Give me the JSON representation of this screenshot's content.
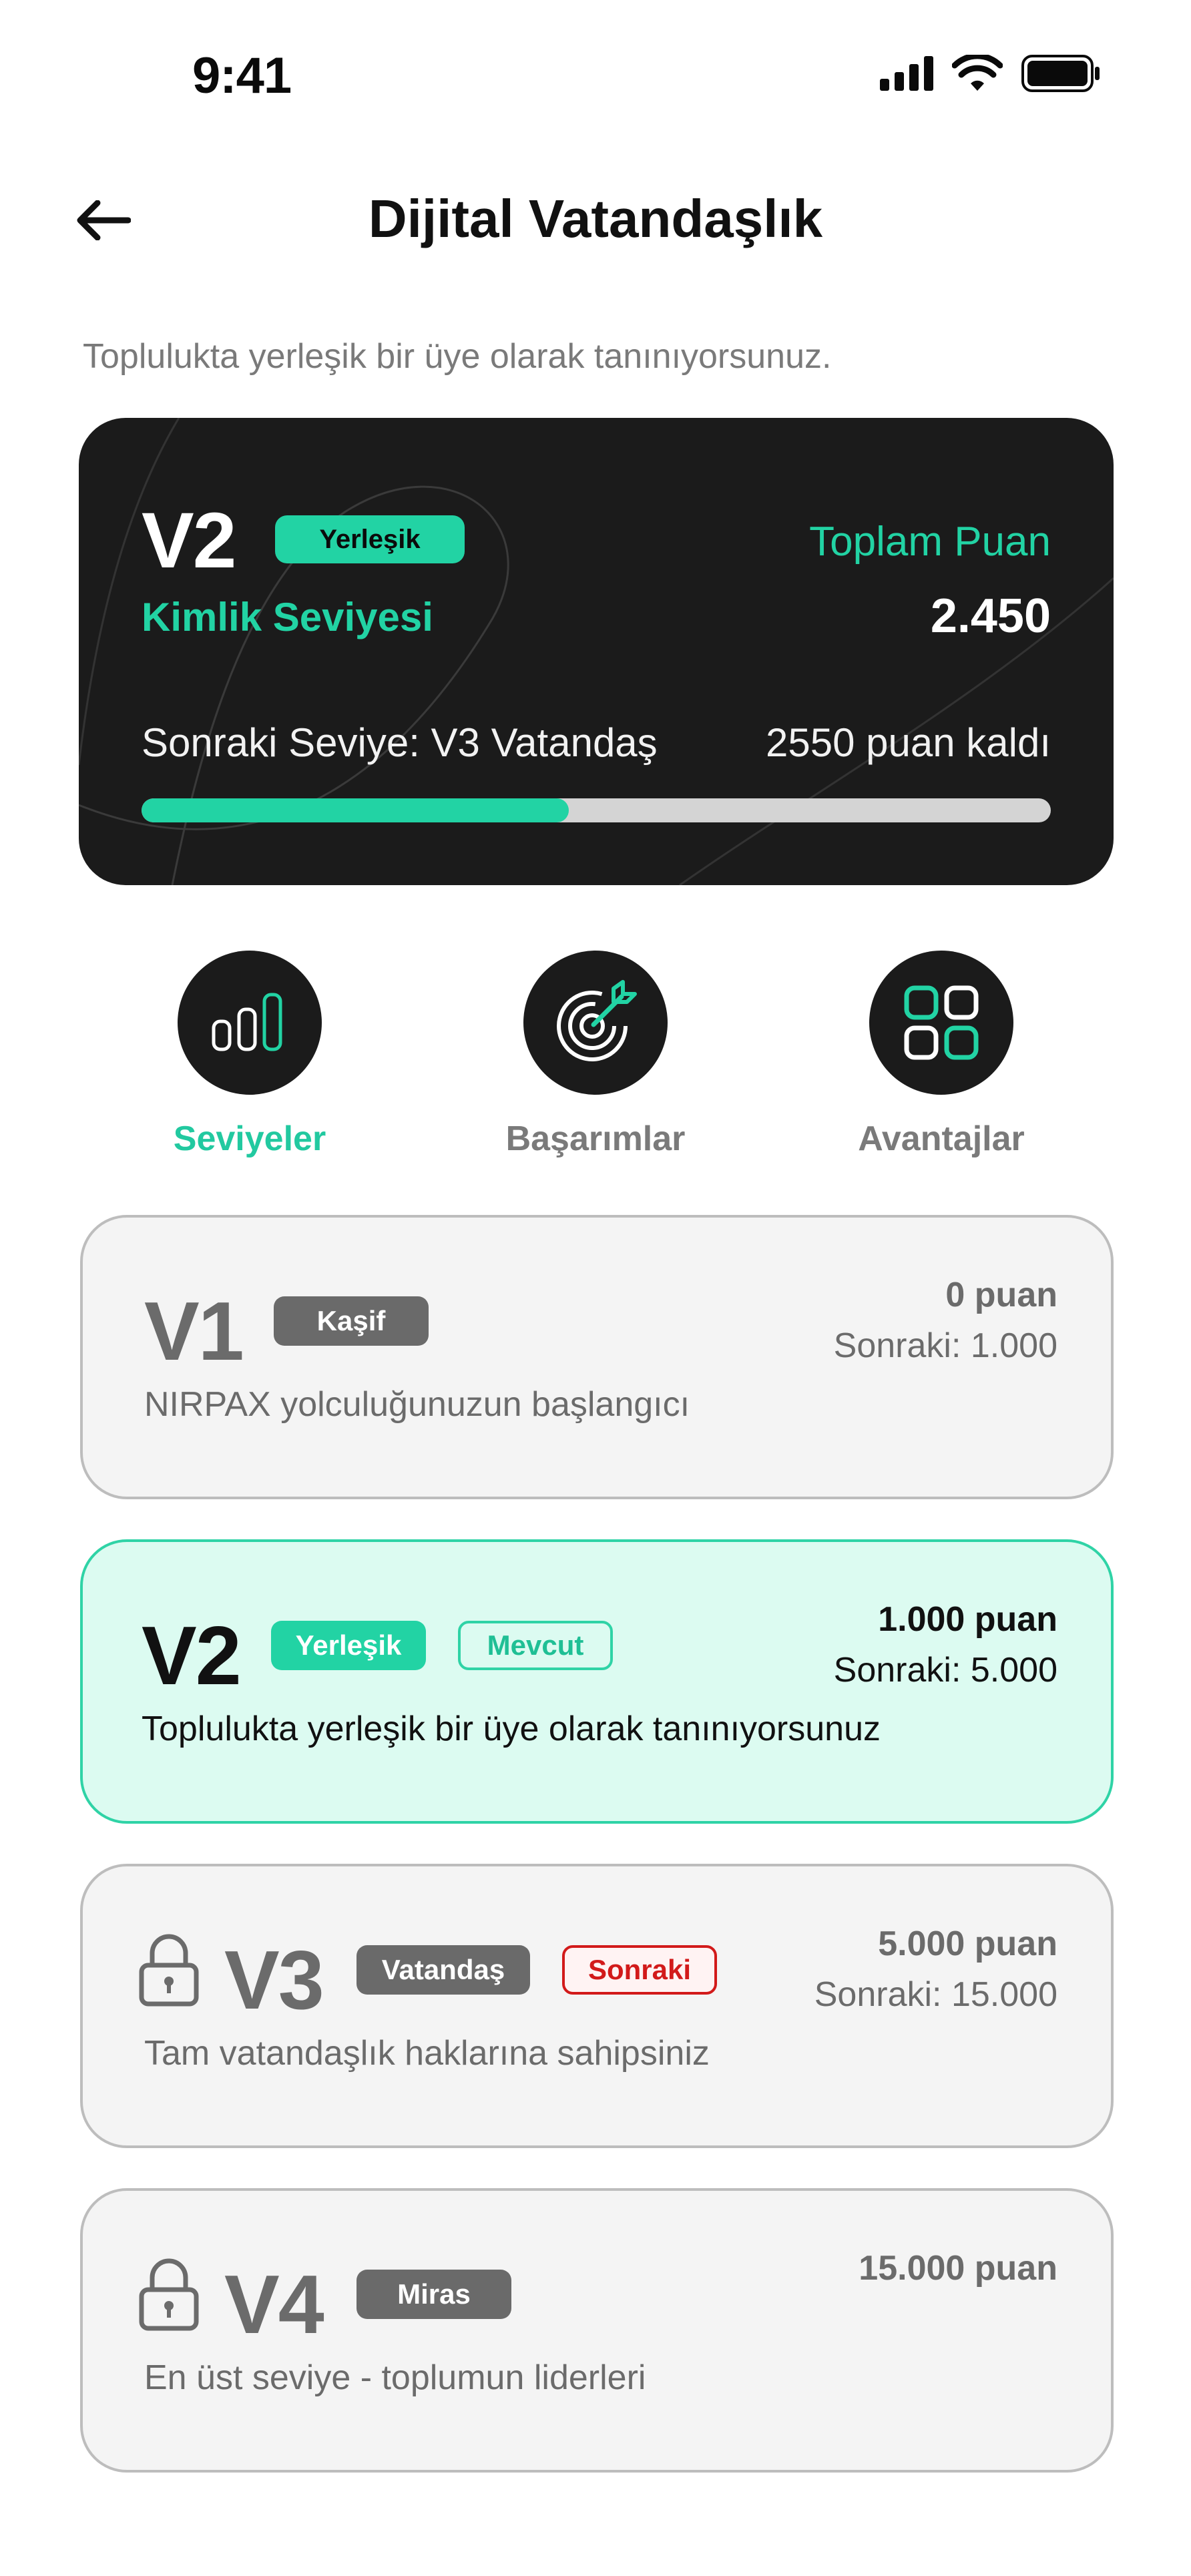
{
  "status_bar": {
    "time": "9:41",
    "icons": [
      "signal-icon",
      "wifi-icon",
      "battery-icon"
    ]
  },
  "header": {
    "title": "Dijital Vatandaşlık",
    "back_icon": "arrow-left-icon"
  },
  "subtitle": "Toplulukta yerleşik bir üye olarak tanınıyorsunuz.",
  "hero": {
    "level": "V2",
    "badge": "Yerleşik",
    "sublabel": "Kimlik Seviyesi",
    "points_label": "Toplam Puan",
    "points_value": "2.450",
    "next_label": "Sonraki Seviye: V3 Vatandaş",
    "remaining": "2550 puan kaldı",
    "progress": 0.47
  },
  "tabs": [
    {
      "label": "Seviyeler",
      "icon": "bar-chart-icon",
      "active": true
    },
    {
      "label": "Başarımlar",
      "icon": "target-icon",
      "active": false
    },
    {
      "label": "Avantajlar",
      "icon": "grid-icon",
      "active": false
    }
  ],
  "levels": [
    {
      "code": "V1",
      "tag": "Kaşif",
      "points": "0 puan",
      "next": "Sonraki: 1.000",
      "desc": "NIRPAX yolculuğunuzun başlangıcı",
      "locked": false
    },
    {
      "code": "V2",
      "tag": "Yerleşik",
      "extra_tag": "Mevcut",
      "points": "1.000 puan",
      "next": "Sonraki: 5.000",
      "desc": "Toplulukta yerleşik bir üye olarak tanınıyorsunuz",
      "locked": false
    },
    {
      "code": "V3",
      "tag": "Vatandaş",
      "extra_tag": "Sonraki",
      "points": "5.000 puan",
      "next": "Sonraki: 15.000",
      "desc": "Tam vatandaşlık haklarına sahipsiniz",
      "locked": true
    },
    {
      "code": "V4",
      "tag": "Miras",
      "points": "15.000 puan",
      "desc": "En üst seviye - toplumun liderleri",
      "locked": true
    }
  ],
  "colors": {
    "accent": "#22d3a4",
    "dark": "#1b1b1b",
    "danger": "#d21a1a",
    "muted": "#6b6b6b"
  }
}
